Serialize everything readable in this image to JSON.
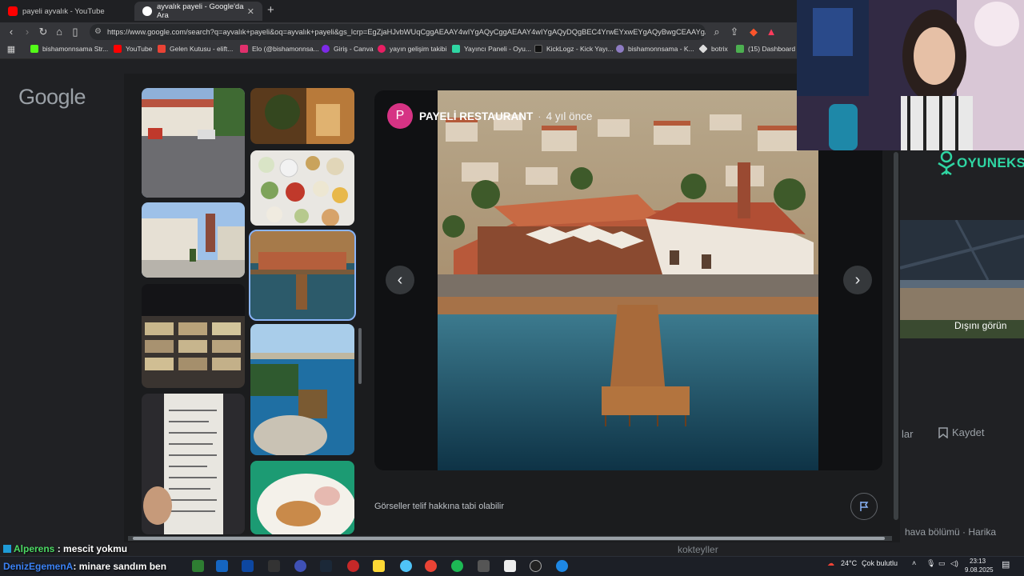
{
  "browser": {
    "tabs": [
      {
        "title": "payeli ayvalık - YouTube",
        "color": "#ff0000"
      },
      {
        "title": "ayvalık payeli - Google'da Ara",
        "color": "#ffffff"
      }
    ],
    "url": "https://www.google.com/search?q=ayvalık+payeli&oq=ayvalık+payeli&gs_lcrp=EgZjaHJvbWUqCggAEAAY4wIYgAQyCggAEAAY4wIYgAQyDQgBEC4YrwEYxwEYgAQyBwgCEAAYgAQ...",
    "bookmarks": [
      {
        "label": "bishamonnsama Str...",
        "color": "#53fc18"
      },
      {
        "label": "YouTube",
        "color": "#ff0000"
      },
      {
        "label": "Gelen Kutusu - elift...",
        "color": "#ea4335"
      },
      {
        "label": "Elo (@bishamonnsa...",
        "color": "#e1306c"
      },
      {
        "label": "Giriş - Canva",
        "color": "#7d2ae8"
      },
      {
        "label": "yayın gelişim takibi",
        "color": "#e91e63"
      },
      {
        "label": "Yayıncı Paneli - Oyu...",
        "color": "#2fd6a3"
      },
      {
        "label": "KickLogz - Kick Yayı...",
        "color": "#111111"
      },
      {
        "label": "bishamonnsama - K...",
        "color": "#8e7cc3"
      },
      {
        "label": "botrix",
        "color": "#dddddd"
      },
      {
        "label": "(15) Dashboard /...",
        "color": "#4caf50"
      }
    ]
  },
  "page": {
    "logo": "Google",
    "viewer": {
      "source_initial": "P",
      "source_name": "PAYELİ RESTAURANT",
      "separator": "·",
      "time": "4 yıl önce",
      "prev": "‹",
      "next": "›"
    },
    "copyright_notice": "Görseller telif hakkına tabi olabilir",
    "right_panel": {
      "street_view_label": "Dışını görün",
      "save_label": "Kaydet",
      "partial_label": "lar",
      "review_snippet": "hava bölümü · Harika",
      "bottom_word": "kokteyller"
    }
  },
  "stream": {
    "brand": "OYUNEKS",
    "chat": [
      {
        "user": "Alperens",
        "message": ": mescit yokmu"
      },
      {
        "user": "DenizEgemenA",
        "message": ": minare sandım ben"
      }
    ]
  },
  "taskbar": {
    "weather_temp": "24°C",
    "weather_text": "Çok bulutlu",
    "time": "23:13",
    "date": "9.08.2025"
  }
}
